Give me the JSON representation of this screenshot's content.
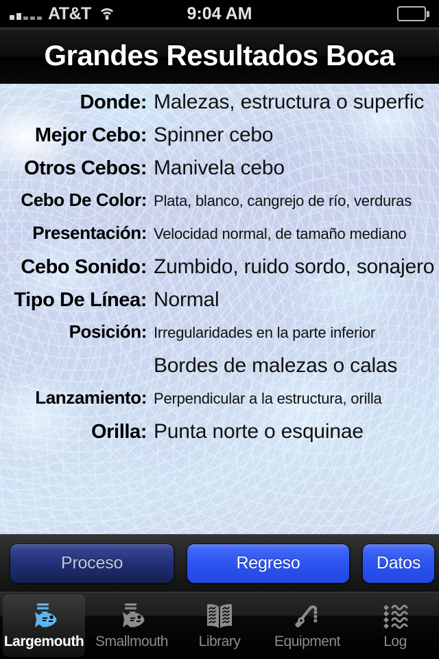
{
  "status_bar": {
    "carrier": "AT&T",
    "time": "9:04 AM",
    "signal_bars_filled": 2,
    "signal_bars_total": 5,
    "wifi": "wifi-icon",
    "battery": "battery-full-icon"
  },
  "nav": {
    "title": "Grandes Resultados Boca"
  },
  "detail_rows": [
    {
      "label": "Donde:",
      "value": "Malezas, estructura o superfic",
      "size": "lg"
    },
    {
      "label": "Mejor Cebo:",
      "value": "Spinner cebo",
      "size": "lg"
    },
    {
      "label": "Otros Cebos:",
      "value": "Manivela cebo",
      "size": "lg"
    },
    {
      "label": "Cebo De Color:",
      "value": "Plata, blanco, cangrejo de río, verduras",
      "size": "sm"
    },
    {
      "label": "Presentación:",
      "value": "Velocidad normal, de tamaño mediano",
      "size": "sm"
    },
    {
      "label": "Cebo Sonido:",
      "value": "Zumbido, ruido sordo, sonajero",
      "size": "lg"
    },
    {
      "label": "Tipo De Línea:",
      "value": "Normal",
      "size": "lg"
    },
    {
      "label": "Posición:",
      "value": "Irregularidades en la parte inferior",
      "size": "sm"
    },
    {
      "label": "",
      "value": "Bordes de malezas o calas",
      "size": "lg",
      "continuation": true
    },
    {
      "label": "Lanzamiento:",
      "value": "Perpendicular a la estructura, orilla",
      "size": "sm"
    },
    {
      "label": "Orilla:",
      "value": "Punta norte o esquinae",
      "size": "lg"
    }
  ],
  "toolbar": {
    "process_label": "Proceso",
    "back_label": "Regreso",
    "data_label": "Datos"
  },
  "tabs": [
    {
      "label": "Largemouth",
      "icon": "fish-largemouth-icon",
      "selected": true
    },
    {
      "label": "Smallmouth",
      "icon": "fish-smallmouth-icon",
      "selected": false
    },
    {
      "label": "Library",
      "icon": "open-book-icon",
      "selected": false
    },
    {
      "label": "Equipment",
      "icon": "fishing-rod-icon",
      "selected": false
    },
    {
      "label": "Log",
      "icon": "wave-list-icon",
      "selected": false
    }
  ],
  "colors": {
    "accent_blue": "#2a52ef",
    "dim_blue": "#1f2e74",
    "selected_tab_icon": "#5bb6ee",
    "water_background": "#c9d6ee"
  }
}
